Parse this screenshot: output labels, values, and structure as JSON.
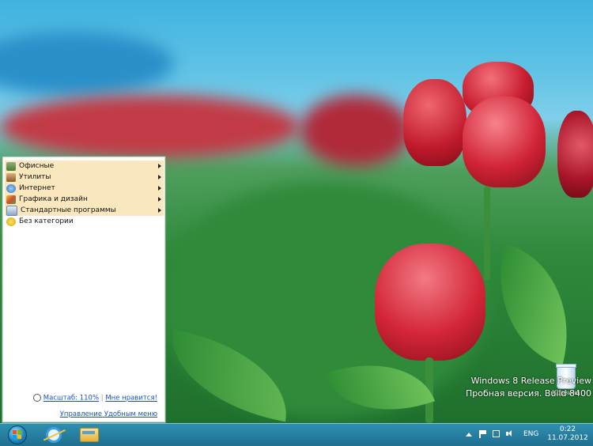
{
  "menu": {
    "items": [
      {
        "label": "Офисные",
        "submenu": true
      },
      {
        "label": "Утилиты",
        "submenu": true
      },
      {
        "label": "Интернет",
        "submenu": true
      },
      {
        "label": "Графика и дизайн",
        "submenu": true
      },
      {
        "label": "Стандартные программы",
        "submenu": true
      },
      {
        "label": "Без категории",
        "submenu": false
      }
    ],
    "zoom_link": "Масштаб: 110%",
    "separator": "|",
    "like_link": "Мне нравится!",
    "manage_link": "Управление Удобным меню"
  },
  "watermark": {
    "line1": "Windows 8 Release Preview",
    "line2": "Пробная версия. Build 8400"
  },
  "desktop": {
    "recycle_bin_label": "Корзина"
  },
  "tray": {
    "language": "ENG",
    "time": "0:22",
    "date": "11.07.2012"
  },
  "colors": {
    "menu_highlight": "#fbe7bd",
    "link": "#1a4fbf",
    "taskbar": "#1f6f90"
  }
}
